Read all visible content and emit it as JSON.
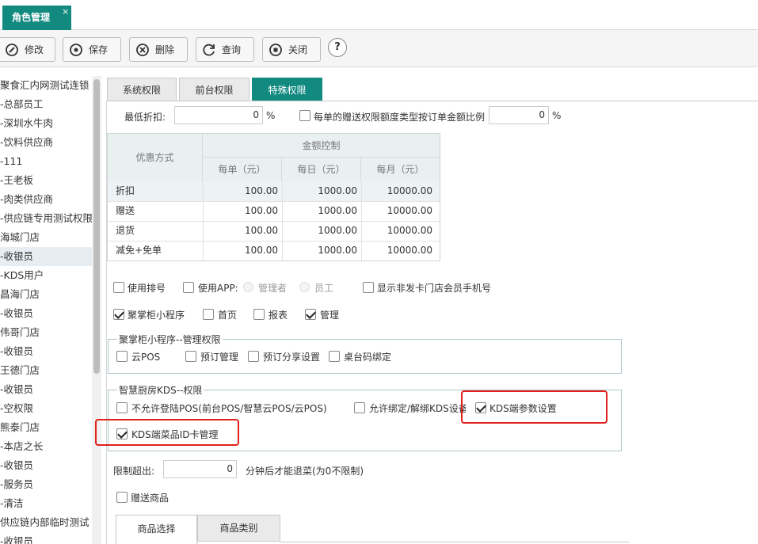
{
  "tabs": {
    "main": "角色管理",
    "close": "×"
  },
  "toolbar": {
    "edit": "修改",
    "save": "保存",
    "delete": "删除",
    "query": "查询",
    "close": "关闭",
    "help": "?"
  },
  "tree": [
    "聚食汇内网测试连锁",
    "-总部员工",
    "-深圳水牛肉",
    "-饮料供应商",
    "-111",
    "-王老板",
    "-肉类供应商",
    "-供应链专用测试权限",
    "海城门店",
    "-收银员",
    "-KDS用户",
    "昌海门店",
    "-收银员",
    "伟哥门店",
    "-收银员",
    "王德门店",
    "-收银员",
    "-空权限",
    "熊泰门店",
    "-本店之长",
    "-收银员",
    "-服务员",
    "-清洁",
    "供应链内部临时测试",
    "-收银员"
  ],
  "content_tabs": [
    "系统权限",
    "前台权限",
    "特殊权限"
  ],
  "min_discount": {
    "label": "最低折扣:",
    "value": "0",
    "unit": "%"
  },
  "gift_ratio": {
    "label": "每单的赠送权限额度类型按订单金额比例",
    "value": "0",
    "unit": "%",
    "checked": false
  },
  "discount_table": {
    "col_method": "优惠方式",
    "col_group": "金额控制",
    "headers": [
      "每单（元）",
      "每日（元）",
      "每月（元）"
    ],
    "rows": [
      {
        "name": "折扣",
        "per_order": "100.00",
        "per_day": "1000.00",
        "per_month": "10000.00"
      },
      {
        "name": "赠送",
        "per_order": "100.00",
        "per_day": "1000.00",
        "per_month": "10000.00"
      },
      {
        "name": "退货",
        "per_order": "100.00",
        "per_day": "1000.00",
        "per_month": "10000.00"
      },
      {
        "name": "减免+免单",
        "per_order": "100.00",
        "per_day": "1000.00",
        "per_month": "10000.00"
      }
    ]
  },
  "options_row1": {
    "use_queue": "使用排号",
    "use_app": "使用APP:",
    "radio_manager": "管理者",
    "radio_staff": "员工",
    "show_phone": "显示非发卡门店会员手机号"
  },
  "options_row2": {
    "mini_program": "聚掌柜小程序",
    "home": "首页",
    "report": "报表",
    "manage": "管理"
  },
  "mini_mgmt": {
    "legend": "聚掌柜小程序--管理权限",
    "items": [
      "云POS",
      "预订管理",
      "预订分享设置",
      "桌台码绑定"
    ]
  },
  "kds": {
    "legend": "智慧厨房KDS--权限",
    "no_login": "不允许登陆POS(前台POS/智慧云POS/云POS)",
    "bind": "允许绑定/解绑KDS设备",
    "params": "KDS端参数设置",
    "dish_id": "KDS端菜品ID卡管理"
  },
  "limit": {
    "label": "限制超出:",
    "value": "0",
    "suffix": "分钟后才能退菜(为0不限制)"
  },
  "gift_goods": "赠送商品",
  "bottom_tabs": [
    "商品选择",
    "商品类别"
  ],
  "colors": {
    "accent": "#128a80",
    "highlight": "#e0201b"
  }
}
